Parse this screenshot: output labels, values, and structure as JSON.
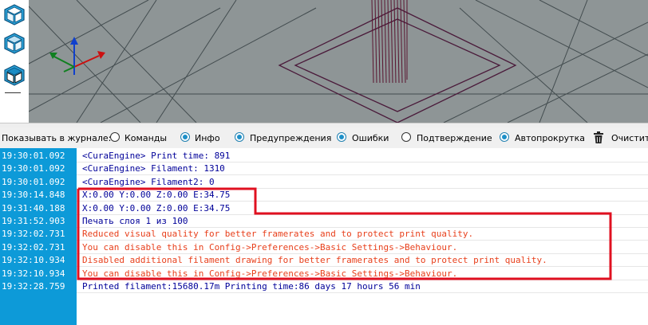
{
  "toolbar": {
    "buttons": [
      {
        "name": "view-iso-cube-icon"
      },
      {
        "name": "view-front-cube-icon"
      },
      {
        "name": "view-wire-cube-icon"
      }
    ]
  },
  "filter_bar": {
    "label": "Показывать в журнале:",
    "options": [
      {
        "label": "Команды",
        "checked": false
      },
      {
        "label": "Инфо",
        "checked": true
      },
      {
        "label": "Предупреждения",
        "checked": true
      },
      {
        "label": "Ошибки",
        "checked": true
      },
      {
        "label": "Подтверждение",
        "checked": false
      },
      {
        "label": "Автопрокрутка",
        "checked": true
      }
    ],
    "clear_label": "Очистить"
  },
  "log": {
    "rows": [
      {
        "time": "19:30:01.092",
        "text": "<CuraEngine> Print time: 891",
        "type": "info"
      },
      {
        "time": "19:30:01.092",
        "text": "<CuraEngine> Filament: 1310",
        "type": "info"
      },
      {
        "time": "19:30:01.092",
        "text": "<CuraEngine> Filament2: 0",
        "type": "info"
      },
      {
        "time": "19:30:14.848",
        "text": "X:0.00 Y:0.00 Z:0.00 E:34.75",
        "type": "info"
      },
      {
        "time": "19:31:40.188",
        "text": "X:0.00 Y:0.00 Z:0.00 E:34.75",
        "type": "info"
      },
      {
        "time": "19:31:52.903",
        "text": "Печать слоя 1 из 100",
        "type": "info"
      },
      {
        "time": "19:32:02.731",
        "text": "Reduced visual quality for better framerates and to protect print quality.",
        "type": "warning"
      },
      {
        "time": "19:32:02.731",
        "text": "You can disable this in Config->Preferences->Basic Settings->Behaviour.",
        "type": "warning"
      },
      {
        "time": "19:32:10.934",
        "text": "Disabled additional filament drawing for better framerates and to protect print quality.",
        "type": "warning"
      },
      {
        "time": "19:32:10.934",
        "text": "You can disable this in Config->Preferences->Basic Settings->Behaviour.",
        "type": "warning"
      },
      {
        "time": "19:32:28.759",
        "text": "Printed filament:15680.17m Printing time:86 days 17 hours 56 min",
        "type": "info"
      }
    ]
  },
  "colors": {
    "info_text": "#000099",
    "warning_text": "#e8401c",
    "timestamp_bg": "#0d9ad8",
    "annotation": "#e01020",
    "viewport_bg": "#8e9596"
  }
}
